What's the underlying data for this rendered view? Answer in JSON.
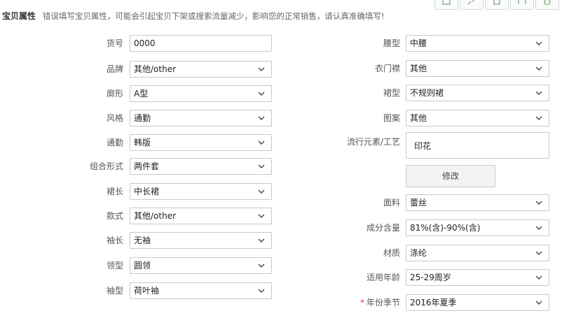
{
  "header": {
    "title": "宝贝属性",
    "tip": "错误填写宝贝属性，可能会引起宝贝下架或搜索流量减少，影响您的正常销售，请认真准确填写!"
  },
  "toolbar_icons": [
    "image-icon",
    "expand-icon",
    "copy-icon",
    "frame-icon",
    "settings-icon"
  ],
  "left_fields": [
    {
      "label": "货号",
      "value": "0000",
      "kind": "input"
    },
    {
      "label": "品牌",
      "value": "其他/other",
      "kind": "select"
    },
    {
      "label": "廓形",
      "value": "A型",
      "kind": "select"
    },
    {
      "label": "风格",
      "value": "通勤",
      "kind": "select"
    },
    {
      "label": "通勤",
      "value": "韩版",
      "kind": "select"
    },
    {
      "label": "组合形式",
      "value": "两件套",
      "kind": "select"
    },
    {
      "label": "裙长",
      "value": "中长裙",
      "kind": "select"
    },
    {
      "label": "款式",
      "value": "其他/other",
      "kind": "select"
    },
    {
      "label": "袖长",
      "value": "无袖",
      "kind": "select"
    },
    {
      "label": "领型",
      "value": "圆领",
      "kind": "select"
    },
    {
      "label": "袖型",
      "value": "荷叶袖",
      "kind": "select"
    }
  ],
  "right_fields": {
    "waist": {
      "label": "腰型",
      "value": "中腰"
    },
    "placket": {
      "label": "衣门襟",
      "value": "其他"
    },
    "skirt_type": {
      "label": "裙型",
      "value": "不规则裙"
    },
    "pattern": {
      "label": "图案",
      "value": "其他"
    },
    "trend": {
      "label": "流行元素/工艺",
      "value": "印花"
    },
    "modify_button": "修改",
    "fabric": {
      "label": "面料",
      "value": "蕾丝"
    },
    "composition": {
      "label": "成分含量",
      "value": "81%(含)-90%(含)"
    },
    "material": {
      "label": "材质",
      "value": "涤纶"
    },
    "age": {
      "label": "适用年龄",
      "value": "25-29周岁"
    },
    "season": {
      "label": "年份季节",
      "value": "2016年夏季",
      "required_mark": "*"
    }
  }
}
